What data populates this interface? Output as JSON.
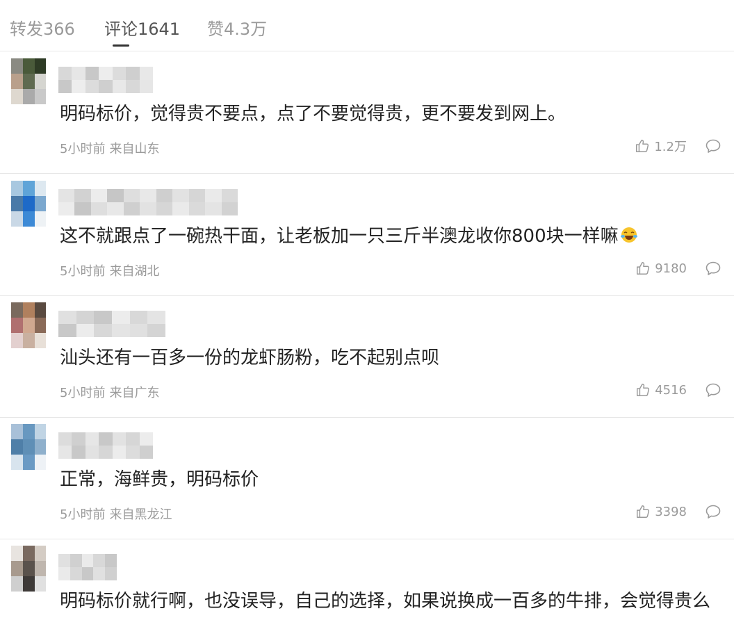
{
  "tabs": [
    {
      "label": "转发366",
      "active": false
    },
    {
      "label": "评论1641",
      "active": true
    },
    {
      "label": "赞4.3万",
      "active": false
    }
  ],
  "comments": [
    {
      "text": "明码标价，觉得贵不要点，点了不要觉得贵，更不要发到网上。",
      "time": "5小时前",
      "location": "来自山东",
      "likes": "1.2万",
      "avatar_colors": [
        "#8a8a82",
        "#4a5a3a",
        "#2e3b25",
        "#b9a08c",
        "#5f6a50",
        "#d5d5d0",
        "#ded8cf",
        "#aaaaaa",
        "#c9c9c9"
      ],
      "name_colors": [
        "#d8d8d8",
        "#e6e6e6",
        "#c8c8c8",
        "#ededed",
        "#dcdcdc",
        "#cfcfcf",
        "#e8e8e8"
      ]
    },
    {
      "text": "这不就跟点了一碗热干面，让老板加一只三斤半澳龙收你800块一样嘛",
      "emoji": "laugh-cry",
      "time": "5小时前",
      "location": "来自湖北",
      "likes": "9180",
      "avatar_colors": [
        "#a8c8e0",
        "#5fa4d8",
        "#dde8f0",
        "#4a7aa8",
        "#1e6ac8",
        "#7ba8cf",
        "#c9d8e6",
        "#3d8ad6",
        "#eef2f5"
      ],
      "name_colors": [
        "#e4e4e4",
        "#d2d2d2",
        "#ececec",
        "#c6c6c6",
        "#dedede",
        "#e8e8e8",
        "#cfcfcf",
        "#e2e2e2",
        "#d6d6d6",
        "#eaeaea",
        "#dadada"
      ]
    },
    {
      "text": "汕头还有一百多一份的龙虾肠粉，吃不起别点呗",
      "time": "5小时前",
      "location": "来自广东",
      "likes": "4516",
      "avatar_colors": [
        "#7a6a5e",
        "#b0805e",
        "#5a4a40",
        "#b07070",
        "#d0a890",
        "#8a6a58",
        "#e3d0cf",
        "#c9b0a0",
        "#e8e0d8"
      ],
      "name_colors": [
        "#e0e0e0",
        "#d4d4d4",
        "#c8c8c8",
        "#ececec",
        "#d8d8d8",
        "#e4e4e4"
      ]
    },
    {
      "text": "正常，海鲜贵，明码标价",
      "time": "5小时前",
      "location": "来自黑龙江",
      "likes": "3398",
      "avatar_colors": [
        "#a8c0d8",
        "#6898c0",
        "#c0d4e4",
        "#4f7fa8",
        "#5f8fb6",
        "#8fb0cc",
        "#d8e4ee",
        "#6a9ac4",
        "#eef2f6"
      ],
      "name_colors": [
        "#dcdcdc",
        "#cfcfcf",
        "#e6e6e6",
        "#c8c8c8",
        "#e2e2e2",
        "#d6d6d6",
        "#ececec"
      ]
    },
    {
      "text": "明码标价就行啊，也没误导，自己的选择，如果说换成一百多的牛排，会觉得贵么",
      "time": "",
      "location": "",
      "likes": "",
      "avatar_colors": [
        "#e8e4e0",
        "#7a6a60",
        "#d4ccc4",
        "#a89a8e",
        "#5a524c",
        "#bfb6ae",
        "#cfcfcf",
        "#3e3a38",
        "#e0e0e0"
      ],
      "name_colors": [
        "#e0e0e0",
        "#d0d0d0",
        "#eaeaea",
        "#d8d8d8",
        "#c8c8c8"
      ]
    }
  ]
}
